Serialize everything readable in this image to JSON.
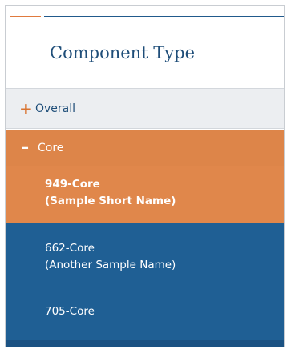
{
  "header": {
    "title": "Component Type"
  },
  "colors": {
    "accent_orange": "#e07a3e",
    "accent_navy": "#215a8c",
    "selected_bg": "#e0874b",
    "item_bg": "#1f5f94"
  },
  "groups": [
    {
      "sign": "+",
      "label": "Overall",
      "expanded": false
    },
    {
      "sign": "–",
      "label": "Core",
      "expanded": true
    }
  ],
  "items": [
    {
      "name": "949-Core",
      "subtitle": "(Sample Short Name)",
      "selected": true
    },
    {
      "name": "662-Core",
      "subtitle": "(Another Sample Name)",
      "selected": false
    },
    {
      "name": "705-Core",
      "subtitle": "",
      "selected": false
    }
  ]
}
